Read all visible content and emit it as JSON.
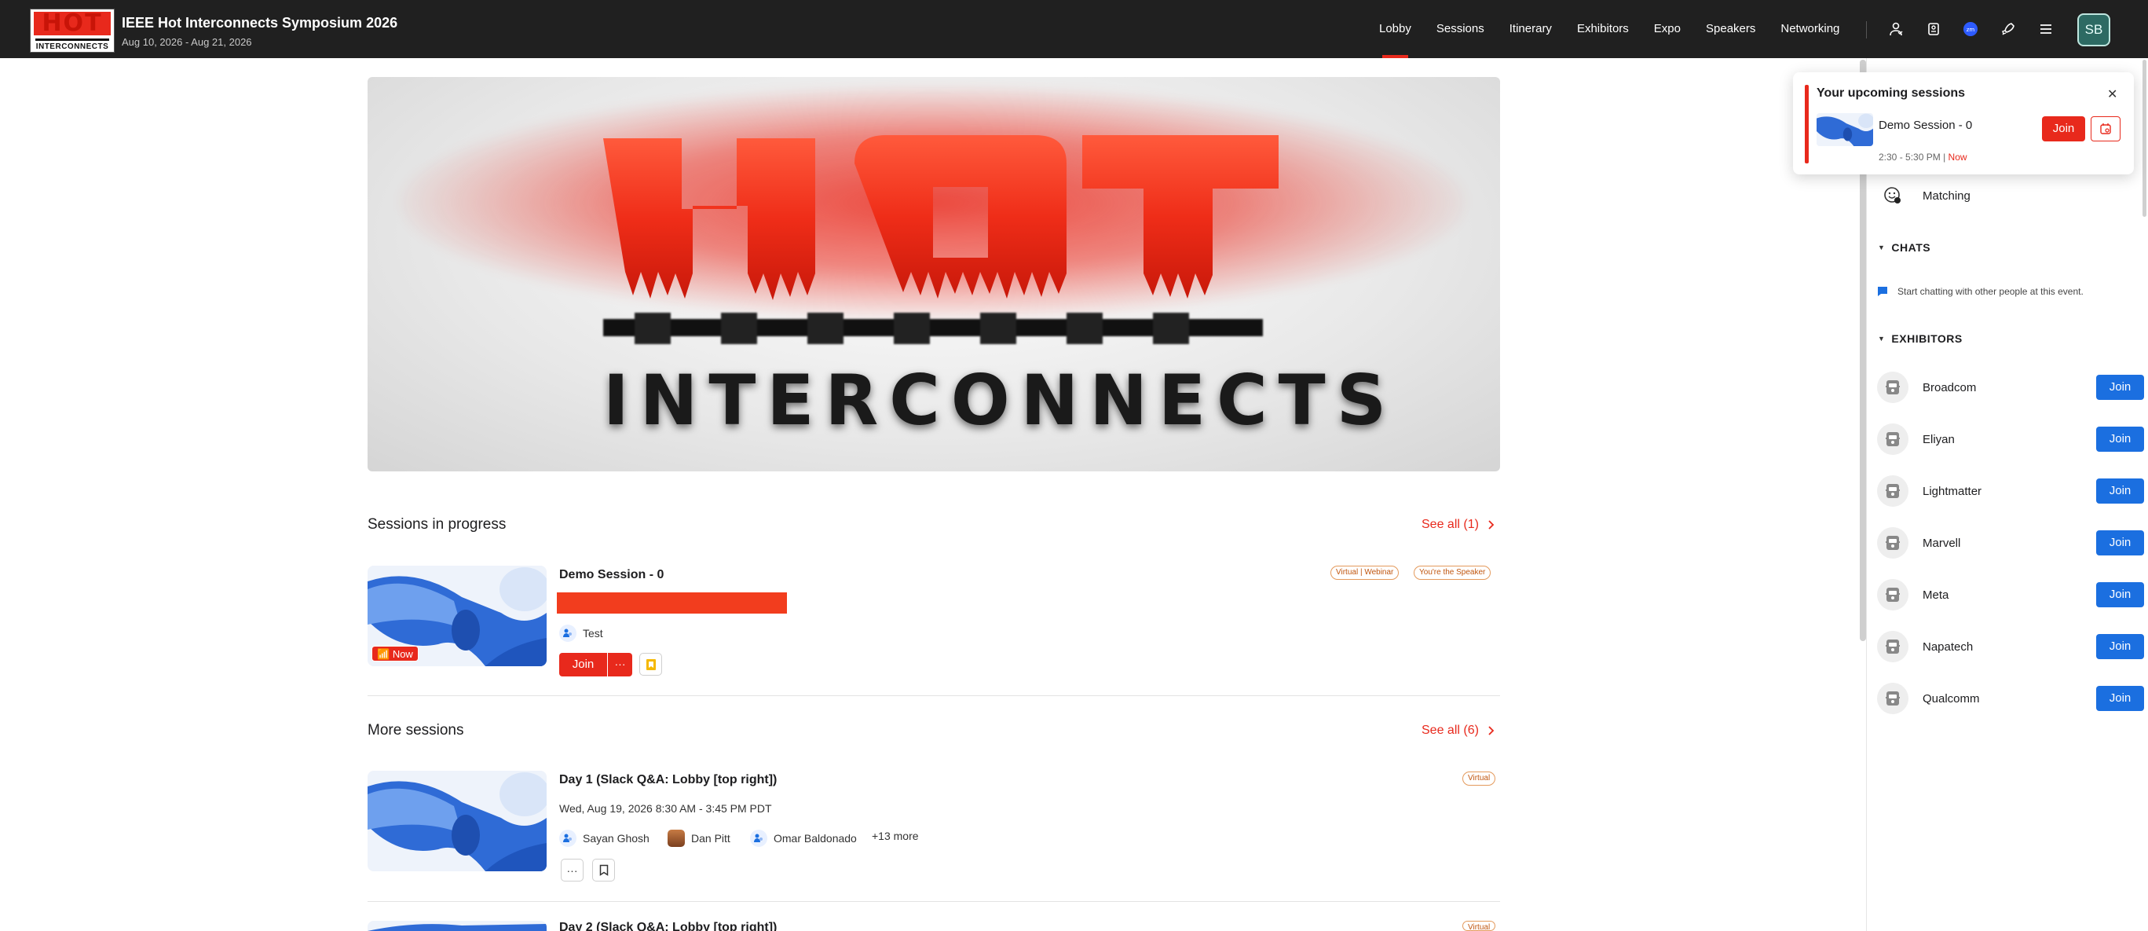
{
  "header": {
    "logo_text": "HOT",
    "logo_subtext": "INTERCONNECTS",
    "event_title": "IEEE Hot Interconnects Symposium 2026",
    "event_dates": "Aug 10, 2026 - Aug 21, 2026",
    "nav": [
      "Lobby",
      "Sessions",
      "Itinerary",
      "Exhibitors",
      "Expo",
      "Speakers",
      "Networking"
    ],
    "active_nav": "Lobby",
    "avatar_initials": "SB",
    "icons": [
      "person-icon",
      "badge-icon",
      "zoom-icon",
      "rocket-icon",
      "menu-icon"
    ]
  },
  "hero": {
    "word": "INTERCONNECTS",
    "hot_letters": "HOT"
  },
  "in_progress": {
    "title": "Sessions in progress",
    "see_all": "See all (1)",
    "session": {
      "name": "Demo Session - 0",
      "tags": [
        "Virtual | Webinar",
        "You're the Speaker"
      ],
      "now_badge": "Now",
      "speaker": "Test",
      "join_label": "Join",
      "more_label": "···"
    }
  },
  "more_sessions": {
    "title": "More sessions",
    "see_all": "See all (6)",
    "sessions": [
      {
        "name": "Day 1 (Slack Q&A: Lobby [top right])",
        "date": "Wed, Aug 19, 2026 8:30 AM - 3:45 PM PDT",
        "tag": "Virtual",
        "speakers": [
          "Sayan Ghosh",
          "Dan Pitt",
          "Omar Baldonado"
        ],
        "more_speakers": "+13 more",
        "more_label": "···"
      },
      {
        "name": "Day 2 (Slack Q&A: Lobby [top right])",
        "tag": "Virtual"
      }
    ]
  },
  "sidebar": {
    "matching_label": "Matching",
    "chats_heading": "CHATS",
    "chats_hint": "Start chatting with other people at this event.",
    "exhibitors_heading": "EXHIBITORS",
    "exhibitors": [
      "Broadcom",
      "Eliyan",
      "Lightmatter",
      "Marvell",
      "Meta",
      "Napatech",
      "Qualcomm"
    ],
    "join_label": "Join"
  },
  "popup": {
    "title": "Your upcoming sessions",
    "session_name": "Demo Session - 0",
    "time": "2:30 - 5:30 PM",
    "time_sep": "|",
    "now_label": "Now",
    "join_label": "Join",
    "close_label": "✕"
  },
  "colors": {
    "accent_red": "#e8291c",
    "join_blue": "#1b6fe0",
    "topbar_bg": "#202020"
  }
}
